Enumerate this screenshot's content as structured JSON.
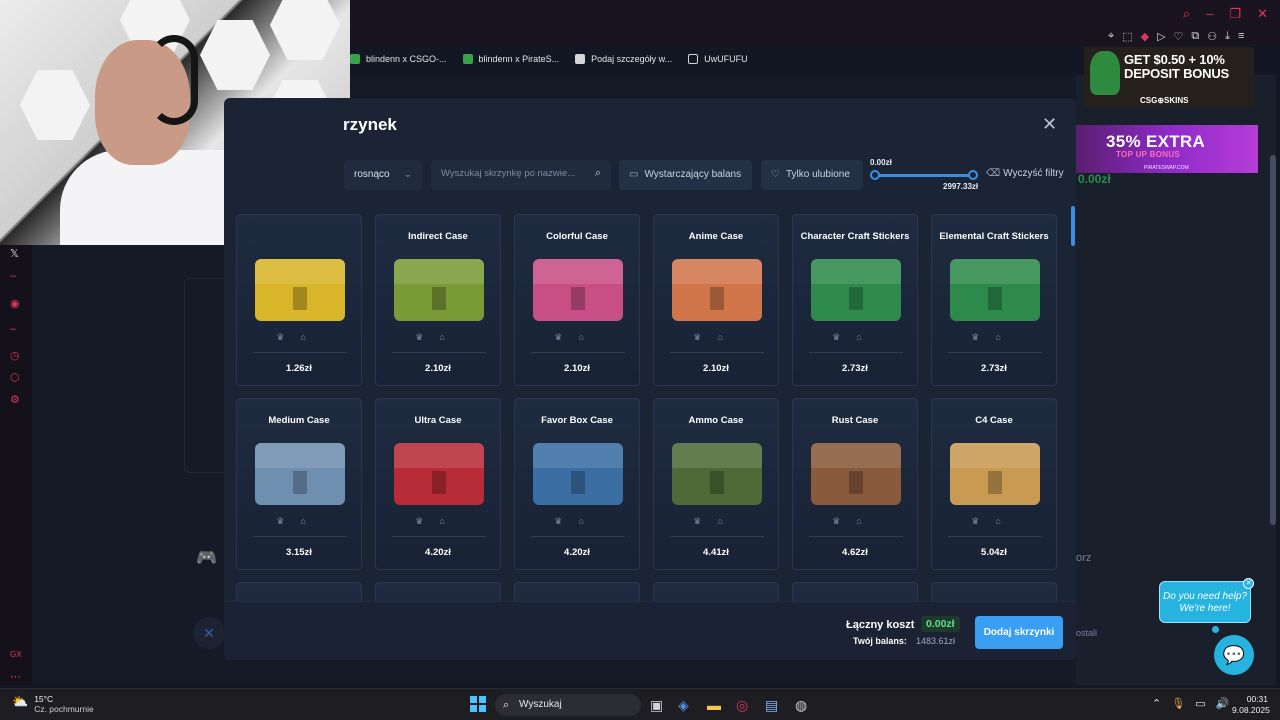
{
  "browser": {
    "bookmarks": [
      "blindenn x CSGO-...",
      "blindenn x PirateS...",
      "Podaj szczegóły w...",
      "UwUFUFU"
    ],
    "controls": [
      "⌕",
      "–",
      "❐",
      "✕"
    ]
  },
  "ads": {
    "ad1_headline": "GET $0.50 + 10%",
    "ad1_sub": "DEPOSIT BONUS",
    "ad1_brand": "CSG⊕SKINS",
    "ad2_headline": "35% EXTRA",
    "ad2_sub": "TOP UP BONUS",
    "ad2_brand": "PIRATESWAP.COM"
  },
  "background": {
    "balance_hint": "0.00zł",
    "button_partial": "orz",
    "text_partial": "ostali"
  },
  "modal": {
    "title": "rzynek",
    "sort_value": "rosnąco",
    "search_placeholder": "Wyszukaj skrzynkę po nazwie...",
    "filter_balance": "Wystarczający balans",
    "filter_favorites": "Tylko ulubione",
    "price_min": "0.00zł",
    "price_max": "2997.33zł",
    "clear_filters": "Wyczyść filtry",
    "cases": [
      {
        "name": "",
        "price": "1.26zł",
        "color": "#d9b52a"
      },
      {
        "name": "Indirect Case",
        "price": "2.10zł",
        "color": "#7a9a36"
      },
      {
        "name": "Colorful Case",
        "price": "2.10zł",
        "color": "#c74f86"
      },
      {
        "name": "Anime Case",
        "price": "2.10zł",
        "color": "#d1764a"
      },
      {
        "name": "Character Craft Stickers",
        "price": "2.73zł",
        "color": "#2f8b4c"
      },
      {
        "name": "Elemental Craft Stickers",
        "price": "2.73zł",
        "color": "#2e8a4a"
      },
      {
        "name": "Medium Case",
        "price": "3.15zł",
        "color": "#6f8fb0"
      },
      {
        "name": "Ultra Case",
        "price": "4.20zł",
        "color": "#b72c36"
      },
      {
        "name": "Favor Box Case",
        "price": "4.20zł",
        "color": "#3b6fa3"
      },
      {
        "name": "Ammo Case",
        "price": "4.41zł",
        "color": "#4f6a36"
      },
      {
        "name": "Rust Case",
        "price": "4.62zł",
        "color": "#8a5a3c"
      },
      {
        "name": "C4 Case",
        "price": "5.04zł",
        "color": "#c99a52"
      }
    ],
    "total_label": "Łączny koszt",
    "total_value": "0.00zł",
    "balance_label": "Twój balans:",
    "balance_value": "1483.61zł",
    "add_button": "Dodaj skrzynki"
  },
  "chat": {
    "bubble_line1": "Do you need help?",
    "bubble_line2": "We're here!"
  },
  "taskbar": {
    "temp": "15°C",
    "weather": "Cz. pochmurnie",
    "search": "Wyszukaj",
    "time": "00:31",
    "date": "9.08.2025"
  },
  "sidebar": {
    "bottom_label": "GX"
  }
}
